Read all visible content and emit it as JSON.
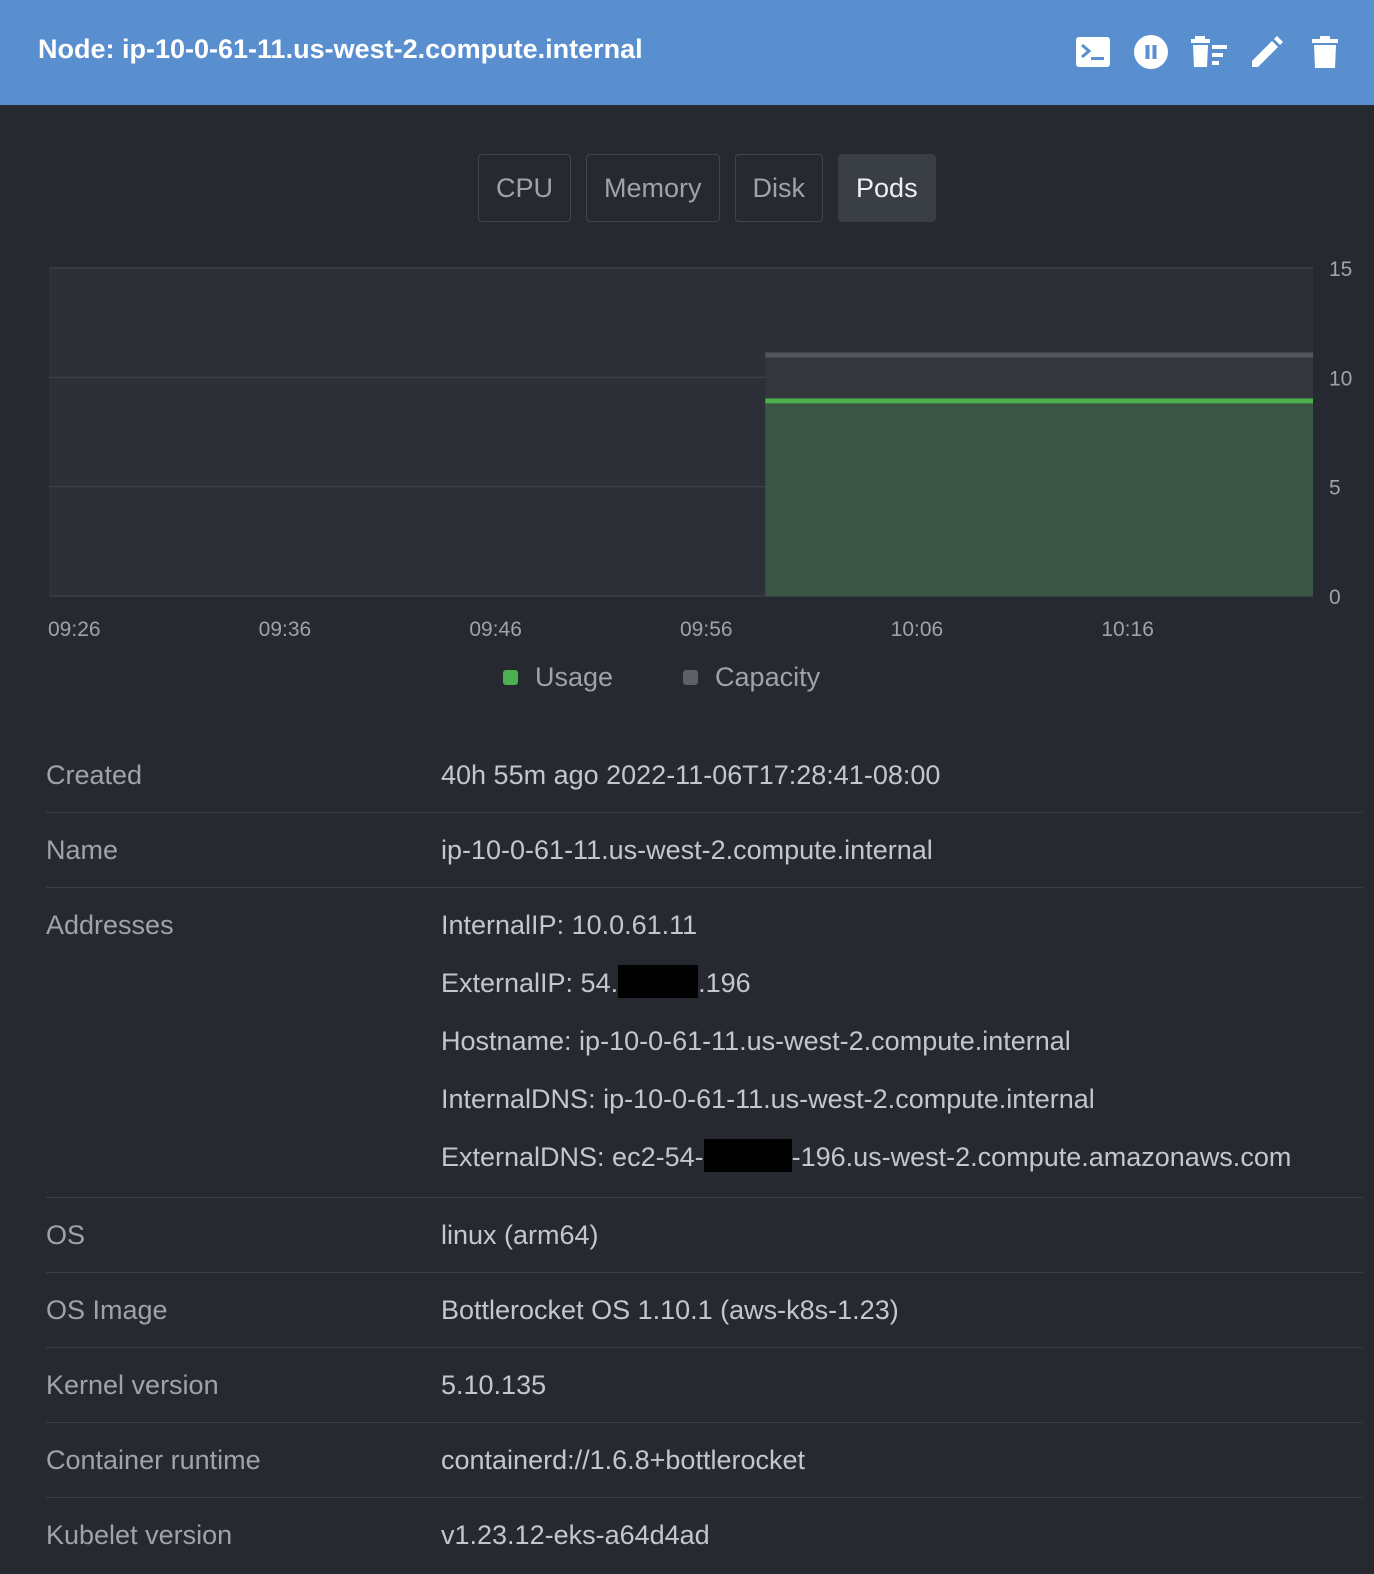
{
  "header": {
    "title": "Node: ip-10-0-61-11.us-west-2.compute.internal",
    "icons": [
      "terminal-icon",
      "pause-icon",
      "drain-icon",
      "edit-icon",
      "delete-icon"
    ]
  },
  "tabs": [
    {
      "label": "CPU",
      "active": false
    },
    {
      "label": "Memory",
      "active": false
    },
    {
      "label": "Disk",
      "active": false
    },
    {
      "label": "Pods",
      "active": true
    }
  ],
  "chart_data": {
    "type": "area",
    "x_ticks": [
      "09:26",
      "09:36",
      "09:46",
      "09:56",
      "10:06",
      "10:16"
    ],
    "y_ticks": [
      0,
      5,
      10,
      15
    ],
    "ylim": [
      0,
      15
    ],
    "x_start": "09:26",
    "x_end": "10:26",
    "data_start": "10:00",
    "series": [
      {
        "name": "Usage",
        "value": 8.9,
        "color": "#4caf50"
      },
      {
        "name": "Capacity",
        "value": 11,
        "color": "#5c6068"
      }
    ],
    "legend_position": "bottom",
    "grid": true
  },
  "details": [
    {
      "label": "Created",
      "lines": [
        {
          "text": "40h 55m ago 2022-11-06T17:28:41-08:00"
        }
      ]
    },
    {
      "label": "Name",
      "lines": [
        {
          "text": "ip-10-0-61-11.us-west-2.compute.internal"
        }
      ]
    },
    {
      "label": "Addresses",
      "lines": [
        {
          "text": "InternalIP: 10.0.61.11"
        },
        {
          "before": "ExternalIP: 54.",
          "after": ".196"
        },
        {
          "text": "Hostname: ip-10-0-61-11.us-west-2.compute.internal"
        },
        {
          "text": "InternalDNS: ip-10-0-61-11.us-west-2.compute.internal"
        },
        {
          "before": "ExternalDNS: ec2-54-",
          "after": "-196.us-west-2.compute.amazonaws.com"
        }
      ]
    },
    {
      "label": "OS",
      "lines": [
        {
          "text": "linux (arm64)"
        }
      ]
    },
    {
      "label": "OS Image",
      "lines": [
        {
          "text": "Bottlerocket OS 1.10.1 (aws-k8s-1.23)"
        }
      ]
    },
    {
      "label": "Kernel version",
      "lines": [
        {
          "text": "5.10.135"
        }
      ]
    },
    {
      "label": "Container runtime",
      "lines": [
        {
          "text": "containerd://1.6.8+bottlerocket"
        }
      ]
    },
    {
      "label": "Kubelet version",
      "lines": [
        {
          "text": "v1.23.12-eks-a64d4ad"
        }
      ]
    }
  ]
}
